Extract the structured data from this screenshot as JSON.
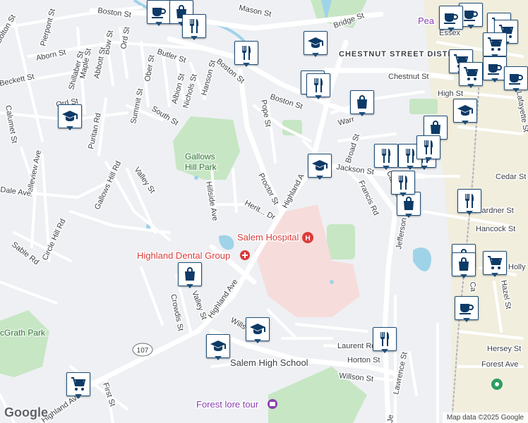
{
  "map": {
    "colors": {
      "land": "#eef0f3",
      "road": "#ffffff",
      "arterial": "#d3d7dd",
      "park": "#c7e6c4",
      "water": "#9fd3e8",
      "hospital": "#f7dcdc",
      "downtown": "#f3edd0",
      "marker_border": "#1f4e79",
      "marker_icon": "#0d3a66"
    },
    "streets": {
      "boston_st_top": "Boston St",
      "mason_st": "Mason St",
      "bridge_st": "Bridge St",
      "bolton_st": "Bolton St",
      "pierpont_st": "Pierpont St",
      "aborn_st": "Aborn St",
      "bow_st": "Bow St",
      "ord_st_top": "Ord St",
      "butler_st": "Butler St",
      "beckett_st": "Beckett St",
      "shillaber_st": "Shillaber St",
      "maple_st": "Maple St",
      "abbott_st": "Abbott St",
      "ober_st": "Ober St",
      "albion_st": "Albion St",
      "nichols_st": "Nichols St",
      "hanson_st": "Hanson St",
      "boston_st_mid": "Boston St",
      "boston_st_east": "Boston St",
      "chestnut_st": "Chestnut St",
      "high_st": "High St",
      "calumet_st": "Calumet St",
      "ord_st_left": "Ord St",
      "summit_st": "Summit St",
      "south_st": "South St",
      "pope_st": "Pope St",
      "warren_st": "Warr",
      "lafayette_st": "Lafayette St",
      "puritan_rd": "Puritan Rd",
      "belleview_ave": "Belleview Ave",
      "gallows_hill_rd": "Gallows Hill Rd",
      "valley_st": "Valley St",
      "hillside_ave": "Hillside Ave",
      "proctor_st": "Proctor St",
      "heritage_dr": "Herit... Dr",
      "highland_ave_north": "Highland A",
      "jackson_st": "Jackson St",
      "broad_st": "Broad St",
      "francis_rd": "Francis Rd",
      "calabrese_st": "Calabrese St",
      "cedar_st": "Cedar St",
      "gardner_st": "Gardner St",
      "hancock_st": "Hancock St",
      "jefferson_ave": "Jefferson Ave",
      "dale_ave": "Dale Ave",
      "circle_hill_rd": "Circle Hill Rd",
      "sable_rd": "Sable Rd",
      "valley_st_south": "Valley St",
      "crowdis_st": "Crowdis St",
      "highland_ave_south": "Highland Ave",
      "highland_ave_sw": "Highland Ave",
      "wilson_st_diag": "Wills",
      "laurent_rd": "Laurent Rd",
      "horton_st": "Horton St",
      "willson_st": "Willson St",
      "lawrence_st": "Lawrence St",
      "first_st": "First St",
      "hersey_st": "Hersey St",
      "forest_ave": "Forest Ave",
      "hazel_st": "Hazel St",
      "holly_st": "Holly",
      "essex_st": "Essex",
      "jefferson_ave_bottom": "Je",
      "canal_st": "Ca",
      "route_107": "107"
    },
    "areas": {
      "chestnut_street_district": "CHESTNUT STREET DISTRICT",
      "gallows_hill_park": [
        "Gallows",
        "Hill Park"
      ],
      "mcgrath_park": "cGrath Park"
    },
    "pois": {
      "salem_hospital": "Salem Hospital",
      "highland_dental_group": "Highland Dental Group",
      "salem_high_school": "Salem High School",
      "forest_lore_tour": "Forest lore tour",
      "pea_top": "Pea"
    },
    "markers": [
      {
        "name": "coffee-marker-1",
        "icon": "coffee"
      },
      {
        "name": "shopping-bag-marker-1",
        "icon": "shopping-bag"
      },
      {
        "name": "restaurant-marker-1",
        "icon": "restaurant"
      },
      {
        "name": "restaurant-marker-2",
        "icon": "restaurant"
      },
      {
        "name": "school-marker-1",
        "icon": "school"
      },
      {
        "name": "coffee-marker-2",
        "icon": "coffee"
      },
      {
        "name": "shopping-cart-marker-1",
        "icon": "shopping-cart"
      },
      {
        "name": "coffee-marker-3",
        "icon": "coffee"
      },
      {
        "name": "shopping-cart-marker-2",
        "icon": "shopping-cart"
      },
      {
        "name": "shopping-cart-marker-3",
        "icon": "shopping-cart"
      },
      {
        "name": "shopping-cart-marker-4",
        "icon": "shopping-cart"
      },
      {
        "name": "coffee-marker-4",
        "icon": "coffee"
      },
      {
        "name": "coffee-marker-5",
        "icon": "coffee"
      },
      {
        "name": "shopping-cart-marker-5",
        "icon": "shopping-cart"
      },
      {
        "name": "restaurant-marker-3",
        "icon": "restaurant"
      },
      {
        "name": "restaurant-marker-4",
        "icon": "restaurant"
      },
      {
        "name": "school-marker-2",
        "icon": "school"
      },
      {
        "name": "shopping-bag-marker-2",
        "icon": "shopping-bag"
      },
      {
        "name": "school-marker-3",
        "icon": "school"
      },
      {
        "name": "shopping-bag-marker-3",
        "icon": "shopping-bag"
      },
      {
        "name": "restaurant-marker-5",
        "icon": "restaurant"
      },
      {
        "name": "restaurant-marker-6",
        "icon": "restaurant"
      },
      {
        "name": "restaurant-marker-7",
        "icon": "restaurant"
      },
      {
        "name": "school-marker-4",
        "icon": "school"
      },
      {
        "name": "restaurant-marker-8",
        "icon": "restaurant"
      },
      {
        "name": "shopping-bag-marker-4",
        "icon": "shopping-bag"
      },
      {
        "name": "restaurant-marker-9",
        "icon": "restaurant"
      },
      {
        "name": "restaurant-marker-10",
        "icon": "restaurant"
      },
      {
        "name": "shopping-bag-marker-5",
        "icon": "shopping-bag"
      },
      {
        "name": "shopping-cart-marker-6",
        "icon": "shopping-cart"
      },
      {
        "name": "shopping-bag-marker-6",
        "icon": "shopping-bag"
      },
      {
        "name": "coffee-marker-6",
        "icon": "coffee"
      },
      {
        "name": "school-marker-5",
        "icon": "school"
      },
      {
        "name": "school-marker-6",
        "icon": "school"
      },
      {
        "name": "restaurant-marker-11",
        "icon": "restaurant"
      },
      {
        "name": "shopping-cart-marker-7",
        "icon": "shopping-cart"
      },
      {
        "name": "shopping-bag-marker-7",
        "icon": "shopping-bag"
      }
    ],
    "branding": {
      "logo": "Google",
      "attribution": "Map data ©2025 Google"
    }
  }
}
